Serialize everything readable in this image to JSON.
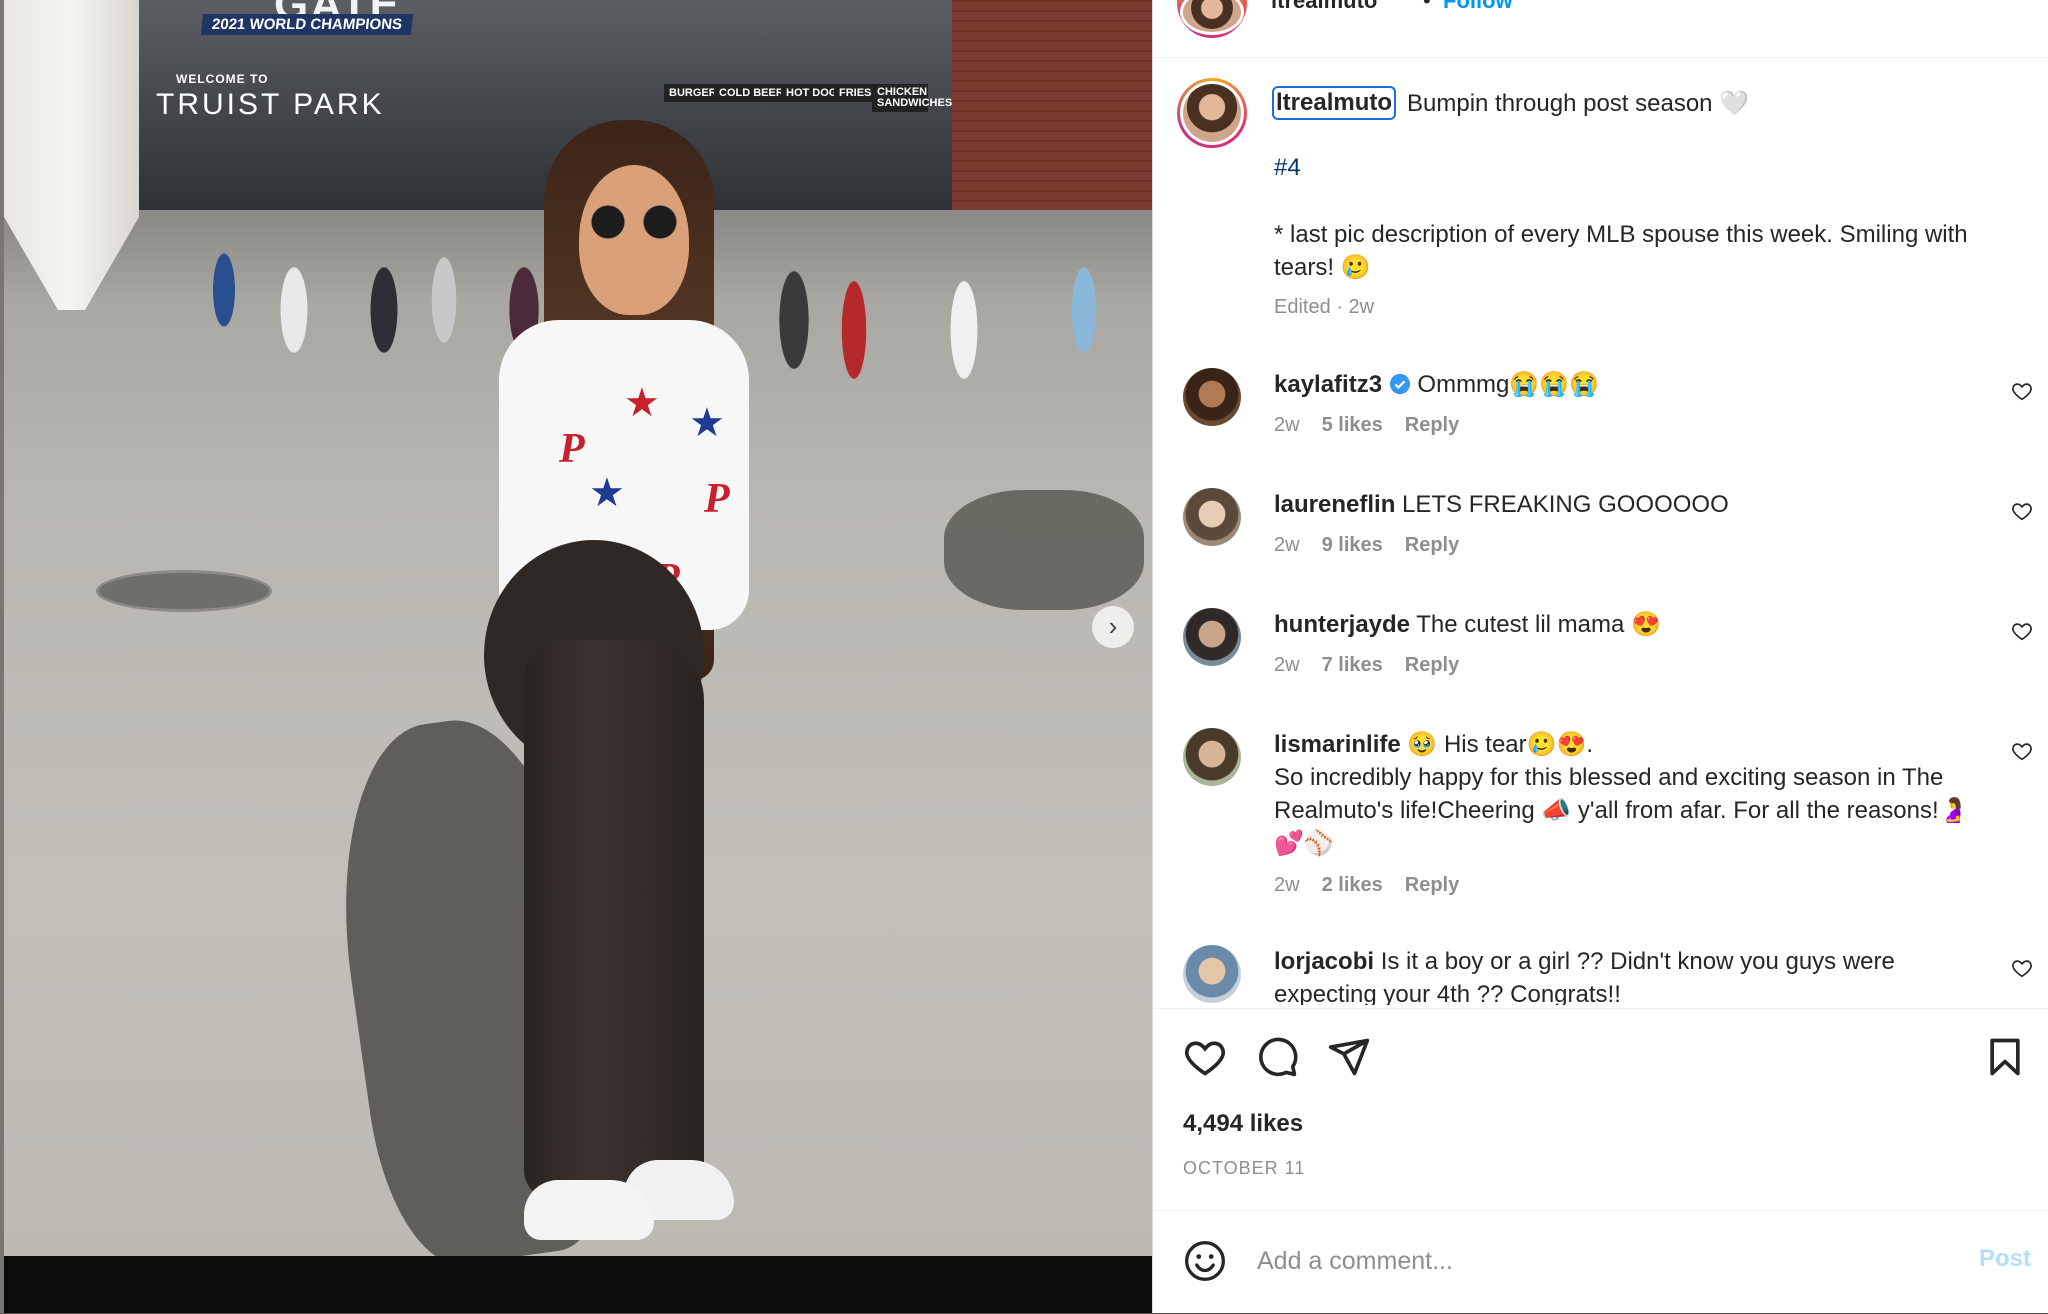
{
  "photo": {
    "gate_title": "GATE",
    "champions_banner": "2021 WORLD CHAMPIONS",
    "welcome_text": "WELCOME TO",
    "park_name": "TRUIST PARK",
    "shop_signs": [
      "BURGERS",
      "COLD BEER",
      "HOT DOGS",
      "FRIES",
      "CHICKEN SANDWICHES"
    ],
    "next_icon": "chevron-right-icon"
  },
  "header": {
    "username": "ltrealmuto",
    "separator": "•",
    "follow_label": "Follow",
    "more_icon": "more-horizontal-icon"
  },
  "caption": {
    "username": "ltrealmuto",
    "text": "Bumpin through post season 🤍",
    "hashtag": "#4",
    "body": "* last pic description of every MLB spouse this week. Smiling with tears! 🥲",
    "meta": "Edited · 2w"
  },
  "comments": [
    {
      "username": "kaylafitz3",
      "verified": true,
      "text": "Ommmg😭😭😭",
      "time": "2w",
      "likes": "5 likes",
      "reply": "Reply"
    },
    {
      "username": "laureneflin",
      "verified": false,
      "text": "LETS FREAKING GOOOOOO",
      "time": "2w",
      "likes": "9 likes",
      "reply": "Reply"
    },
    {
      "username": "hunterjayde",
      "verified": false,
      "text": "The cutest lil mama 😍",
      "time": "2w",
      "likes": "7 likes",
      "reply": "Reply"
    },
    {
      "username": "lismarinlife",
      "verified": false,
      "text": "🥹 His tear🥲😍.\nSo incredibly happy for this blessed and exciting season in The Realmuto's life!Cheering 📣 y'all from afar. For all the reasons!🤰💕⚾",
      "time": "2w",
      "likes": "2 likes",
      "reply": "Reply"
    },
    {
      "username": "lorjacobi",
      "verified": false,
      "text": "Is it a boy or a girl ?? Didn't know you guys were expecting your 4th ?? Congrats!!",
      "time": "",
      "likes": "",
      "reply": ""
    }
  ],
  "actions": {
    "like_icon": "heart-icon",
    "comment_icon": "comment-icon",
    "share_icon": "send-icon",
    "save_icon": "bookmark-icon"
  },
  "likes_count": "4,494 likes",
  "post_date": "OCTOBER 11",
  "add_comment": {
    "emoji_icon": "emoji-icon",
    "placeholder": "Add a comment...",
    "post_label": "Post"
  },
  "colors": {
    "link_blue": "#0095f6",
    "hashtag": "#00376b",
    "muted": "#8e8e8e",
    "post_disabled": "#b2dffc"
  }
}
